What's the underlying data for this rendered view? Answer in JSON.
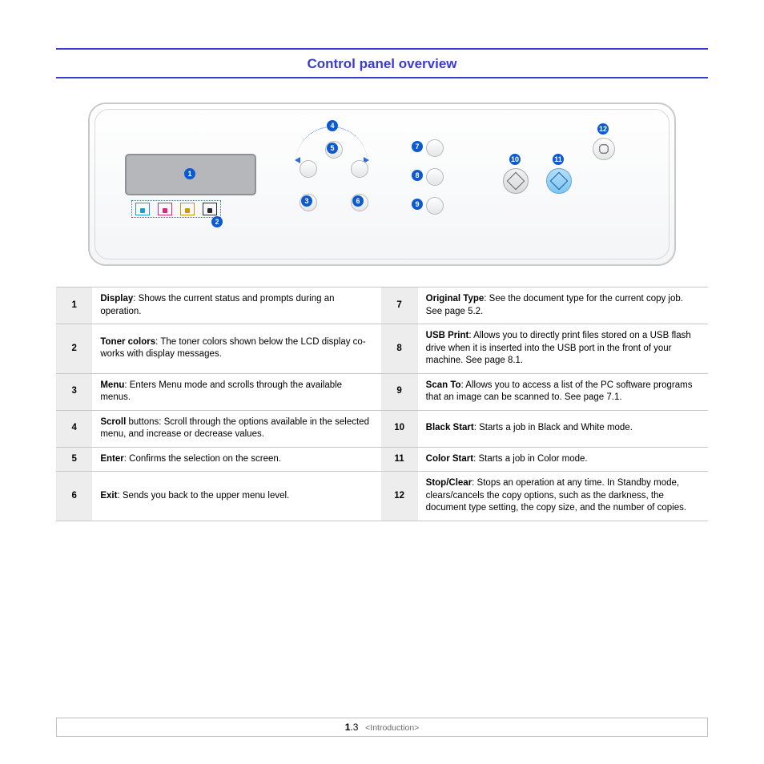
{
  "title": "Control panel overview",
  "callouts": [
    "1",
    "2",
    "3",
    "4",
    "5",
    "6",
    "7",
    "8",
    "9",
    "10",
    "11",
    "12"
  ],
  "rows": [
    {
      "n": "1",
      "term": "Display",
      "desc": ": Shows the current status and prompts during an operation."
    },
    {
      "n": "2",
      "term": "Toner colors",
      "desc": ": The toner colors shown below the LCD display co-works with display messages."
    },
    {
      "n": "3",
      "term": "Menu",
      "desc": ": Enters Menu mode and scrolls through the available menus."
    },
    {
      "n": "4",
      "term": "Scroll",
      "desc": " buttons: Scroll through the options available in the selected menu, and increase or decrease values."
    },
    {
      "n": "5",
      "term": "Enter",
      "desc": ": Confirms the selection on the screen."
    },
    {
      "n": "6",
      "term": "Exit",
      "desc": ": Sends you back to the upper menu level."
    },
    {
      "n": "7",
      "term": "Original Type",
      "desc": ": See the document type for the current copy job. See page 5.2."
    },
    {
      "n": "8",
      "term": "USB Print",
      "desc": ": Allows you to directly print files stored on a USB flash drive when it is inserted into the USB port in the front of your machine. See page 8.1."
    },
    {
      "n": "9",
      "term": "Scan To",
      "desc": ": Allows you to access a list of the PC software programs that an image can be scanned to. See page 7.1."
    },
    {
      "n": "10",
      "term": "Black Start",
      "desc": ": Starts a job in Black and White mode."
    },
    {
      "n": "11",
      "term": "Color Start",
      "desc": ": Starts a job in Color mode."
    },
    {
      "n": "12",
      "term": "Stop/Clear",
      "desc": ": Stops an operation at any time. In Standby mode, clears/cancels the copy options, such as the darkness, the document type setting, the copy size, and the number of copies."
    }
  ],
  "footer": {
    "chapter": "1",
    "page": ".3",
    "section": "<Introduction>"
  }
}
